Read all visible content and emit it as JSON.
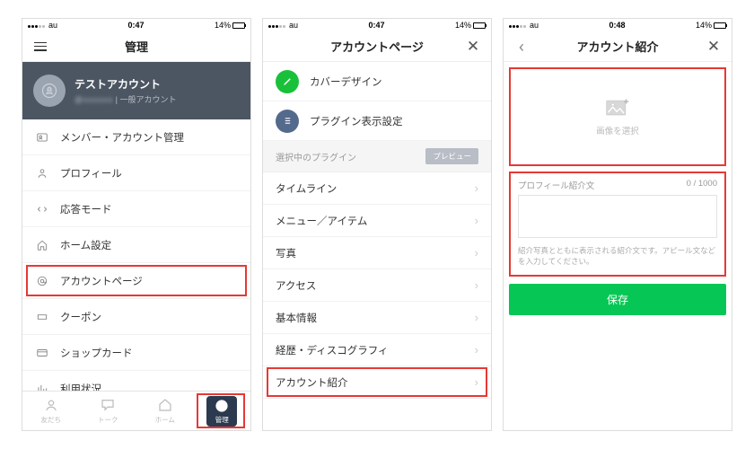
{
  "status": {
    "carrier": "au",
    "time_a": "0:47",
    "time_b": "0:47",
    "time_c": "0:48",
    "battery": "14%"
  },
  "s1": {
    "title": "管理",
    "account_name": "テストアカウント",
    "account_type": "一般アカウント",
    "rows": {
      "members": "メンバー・アカウント管理",
      "profile": "プロフィール",
      "response": "応答モード",
      "home": "ホーム設定",
      "accountpage": "アカウントページ",
      "coupon": "クーポン",
      "shopcard": "ショップカード",
      "usage": "利用状況"
    },
    "tabs": {
      "friends": "友だち",
      "talk": "トーク",
      "home": "ホーム",
      "manage": "管理"
    }
  },
  "s2": {
    "title": "アカウントページ",
    "cover": "カバーデザイン",
    "plugin": "プラグイン表示設定",
    "section": "選択中のプラグイン",
    "preview": "プレビュー",
    "rows": {
      "timeline": "タイムライン",
      "menu": "メニュー／アイテム",
      "photo": "写真",
      "access": "アクセス",
      "basic": "基本情報",
      "history": "経歴・ディスコグラフィ",
      "intro": "アカウント紹介"
    }
  },
  "s3": {
    "title": "アカウント紹介",
    "select_image": "画像を選択",
    "intro_label": "プロフィール紹介文",
    "counter": "0 / 1000",
    "hint": "紹介写真とともに表示される紹介文です。アピール文などを入力してください。",
    "save": "保存"
  }
}
